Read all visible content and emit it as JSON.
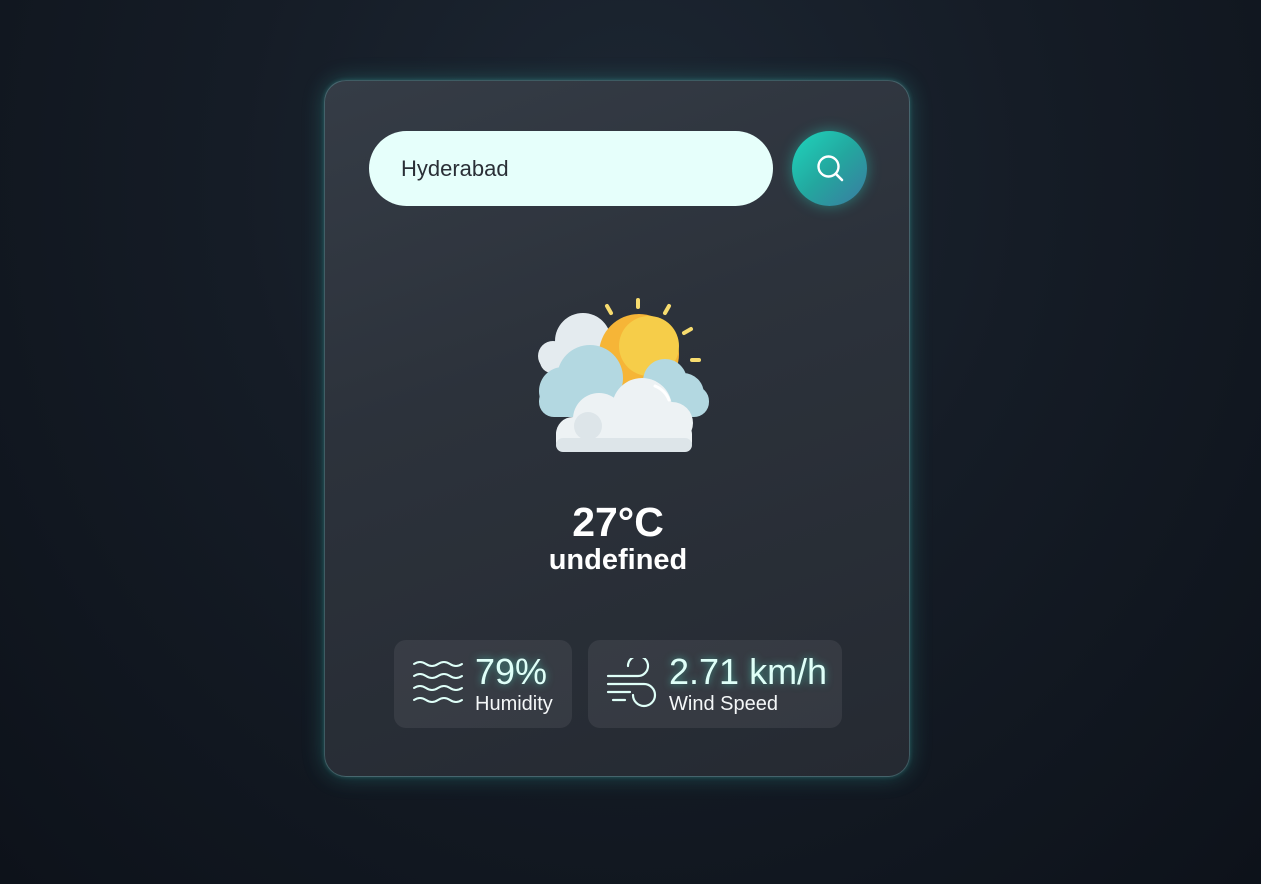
{
  "search": {
    "value": "Hyderabad",
    "placeholder": ""
  },
  "weather": {
    "icon": "partly-cloudy-icon",
    "temperature": "27°C",
    "description": "undefined"
  },
  "stats": {
    "humidity": {
      "icon": "humidity-waves-icon",
      "value": "79%",
      "label": "Humidity"
    },
    "wind": {
      "icon": "wind-icon",
      "value": "2.71 km/h",
      "label": "Wind Speed"
    }
  },
  "colors": {
    "accent": "#1fd6bd",
    "input_background": "#e6fffb",
    "card_glow": "#3cc8be"
  }
}
